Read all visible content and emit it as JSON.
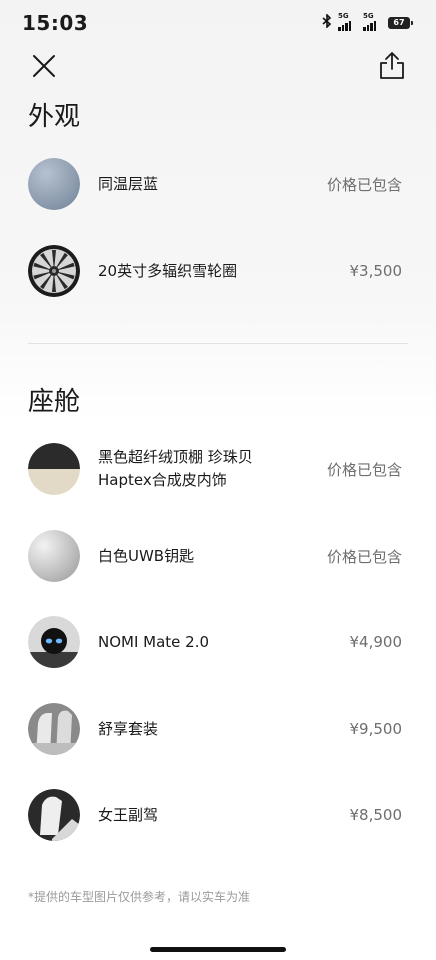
{
  "status_bar": {
    "time": "15:03",
    "bluetooth_icon": "bluetooth-icon",
    "sim1_label": "5G",
    "sim2_label": "5G",
    "battery_level": "67"
  },
  "header": {
    "close_icon": "close-icon",
    "share_icon": "share-icon"
  },
  "sections": [
    {
      "title": "外观",
      "items": [
        {
          "name": "同温层蓝",
          "price": "价格已包含",
          "thumb": "paint-swatch-blue",
          "color": "#8e9daf"
        },
        {
          "name": "20英寸多辐织雪轮圈",
          "price": "¥3,500",
          "thumb": "wheel-image"
        }
      ]
    },
    {
      "title": "座舱",
      "items": [
        {
          "name_line1": "黑色超纤绒顶棚 珍珠贝",
          "name_line2": "Haptex合成皮内饰",
          "price": "价格已包含",
          "thumb": "interior-swatch",
          "colors": [
            "#2b2b2b",
            "#e2d9c6"
          ]
        },
        {
          "name": "白色UWB钥匙",
          "price": "价格已包含",
          "thumb": "key-swatch-white"
        },
        {
          "name": "NOMI Mate 2.0",
          "price": "¥4,900",
          "thumb": "nomi-image"
        },
        {
          "name": "舒享套装",
          "price": "¥9,500",
          "thumb": "seat-image"
        },
        {
          "name": "女王副驾",
          "price": "¥8,500",
          "thumb": "queen-seat-image"
        }
      ]
    }
  ],
  "footnote": "*提供的车型图片仅供参考，请以实车为准"
}
